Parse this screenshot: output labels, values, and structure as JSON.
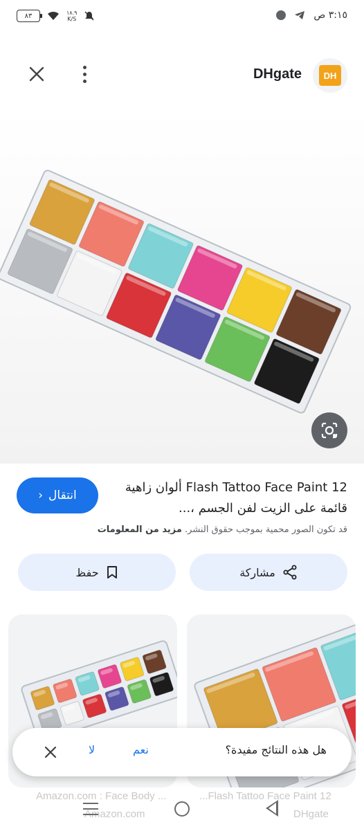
{
  "status_bar": {
    "time": "٣:١٥ ص",
    "battery": "٨٣",
    "net_speed_value": "١٨.٩",
    "net_speed_unit": "K/S"
  },
  "header": {
    "site_name": "DHgate",
    "logo_text": "DH"
  },
  "palette_colors": [
    "#d9a23c",
    "#f07c6e",
    "#b8bcc0",
    "#f4f4f4",
    "#7fd3d6",
    "#e5468f",
    "#d8343a",
    "#f5cc2a",
    "#5a57a8",
    "#6bbf5a",
    "#6b3f2a",
    "#1c1c1c"
  ],
  "result": {
    "title": "Flash Tattoo Face Paint 12 ألوان زاهية قائمة على الزيت لفن الجسم ،...",
    "visit_label": "انتقال",
    "copyright_text": "قد تكون الصور محمية بموجب حقوق النشر.",
    "more_info": "مزيد من المعلومات"
  },
  "actions": {
    "share_label": "مشاركة",
    "save_label": "حفظ"
  },
  "related": {
    "left_title": "Amazon.com : Face Body ...",
    "left_source": "Amazon.com",
    "right_title": "...Flash Tattoo Face Paint 12",
    "right_source": "DHgate"
  },
  "feedback": {
    "question": "هل هذه النتائج مفيدة؟",
    "yes": "نعم",
    "no": "لا"
  }
}
